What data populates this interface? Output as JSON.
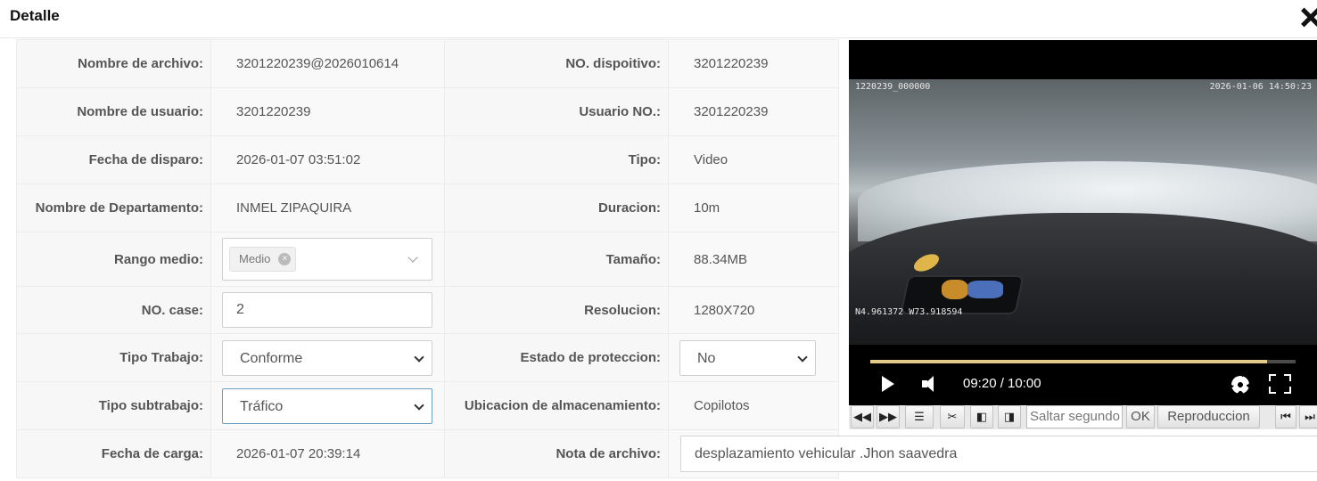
{
  "header": {
    "title": "Detalle"
  },
  "fields": {
    "filename": {
      "label": "Nombre de archivo:",
      "value": "3201220239@2026010614"
    },
    "device_no": {
      "label": "NO. dispoitivo:",
      "value": "3201220239"
    },
    "username": {
      "label": "Nombre de usuario:",
      "value": "3201220239"
    },
    "user_no": {
      "label": "Usuario NO.:",
      "value": "3201220239"
    },
    "trigger_date": {
      "label": "Fecha de disparo:",
      "value": "2026-01-07 03:51:02"
    },
    "type": {
      "label": "Tipo:",
      "value": "Video"
    },
    "department": {
      "label": "Nombre de Departamento:",
      "value": "INMEL ZIPAQUIRA"
    },
    "duration": {
      "label": "Duracion:",
      "value": "10m"
    },
    "media_range": {
      "label": "Rango medio:",
      "tag": "Medio",
      "tag_remove": "×"
    },
    "size": {
      "label": "Tamaño:",
      "value": "88.34MB"
    },
    "case_no": {
      "label": "NO. case:",
      "value": "2"
    },
    "resolution": {
      "label": "Resolucion:",
      "value": "1280X720"
    },
    "work_type": {
      "label": "Tipo Trabajo:",
      "value": "Conforme"
    },
    "protection": {
      "label": "Estado de proteccion:",
      "value": "No"
    },
    "work_subtype": {
      "label": "Tipo subtrabajo:",
      "value": "Tráfico"
    },
    "storage": {
      "label": "Ubicacion de almacenamiento:",
      "value": "Copilotos"
    },
    "upload_date": {
      "label": "Fecha de carga:",
      "value": "2026-01-07 20:39:14"
    },
    "note": {
      "label": "Nota de archivo:",
      "value": "desplazamiento vehicular .Jhon saavedra"
    }
  },
  "player": {
    "osd_left": "1220239_000000",
    "osd_right": "2026-01-06 14:50:23",
    "osd_gps": "N4.961372 W73.918594",
    "time": "09:20 / 10:00",
    "progress_fraction": 0.9333,
    "icons": [
      "play-icon",
      "volume-icon",
      "gear-icon",
      "fullscreen-icon"
    ]
  },
  "toolbar": {
    "rewind": "◀◀",
    "forward": "▶▶",
    "list": "☰",
    "cut": "✂",
    "prev_frame": "◧",
    "next_frame": "◨",
    "seek_placeholder": "Saltar segundo",
    "ok": "OK",
    "playback": "Reproduccion",
    "skip_start": "⏮",
    "skip_end": "⏭"
  },
  "colors": {
    "progress_fill": "#e3c98a",
    "focus_border": "#6aa0c8"
  }
}
